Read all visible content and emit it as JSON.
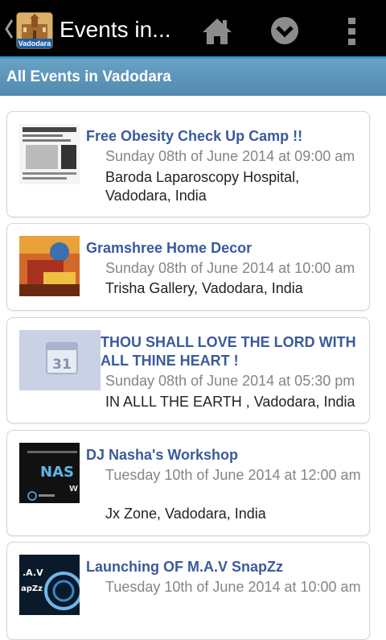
{
  "app": {
    "title": "Events in...",
    "logo_label": "Vadodara"
  },
  "header": {
    "title": "All Events in Vadodara"
  },
  "icons": {
    "back": "chevron-left-icon",
    "home": "home-icon",
    "dropdown": "chevron-down-circle-icon",
    "overflow": "more-vertical-icon",
    "calendar_day": "31"
  },
  "events": [
    {
      "title": "Free Obesity Check Up Camp !!",
      "date": "Sunday 08th of June 2014 at 09:00 am",
      "venue": "Baroda Laparoscopy Hospital, Vadodara, India"
    },
    {
      "title": "Gramshree Home Decor",
      "date": "Sunday 08th of June 2014 at 10:00 am",
      "venue": "Trisha Gallery, Vadodara, India"
    },
    {
      "title": "THOU SHALL LOVE THE LORD WITH ALL THINE HEART !",
      "date": "Sunday 08th of June 2014 at 05:30 pm",
      "venue": "IN ALLL THE EARTH , Vadodara, India"
    },
    {
      "title": "DJ Nasha's Workshop",
      "date": "Tuesday 10th of June 2014 at 12:00 am",
      "venue": "Jx Zone, Vadodara, India"
    },
    {
      "title": "Launching OF M.A.V SnapZz",
      "date": "Tuesday 10th of June 2014 at 10:00 am",
      "venue": ""
    }
  ],
  "colors": {
    "accent": "#2f99c8",
    "header_bg": "#5b95bb",
    "event_title": "#3a5a9c"
  }
}
